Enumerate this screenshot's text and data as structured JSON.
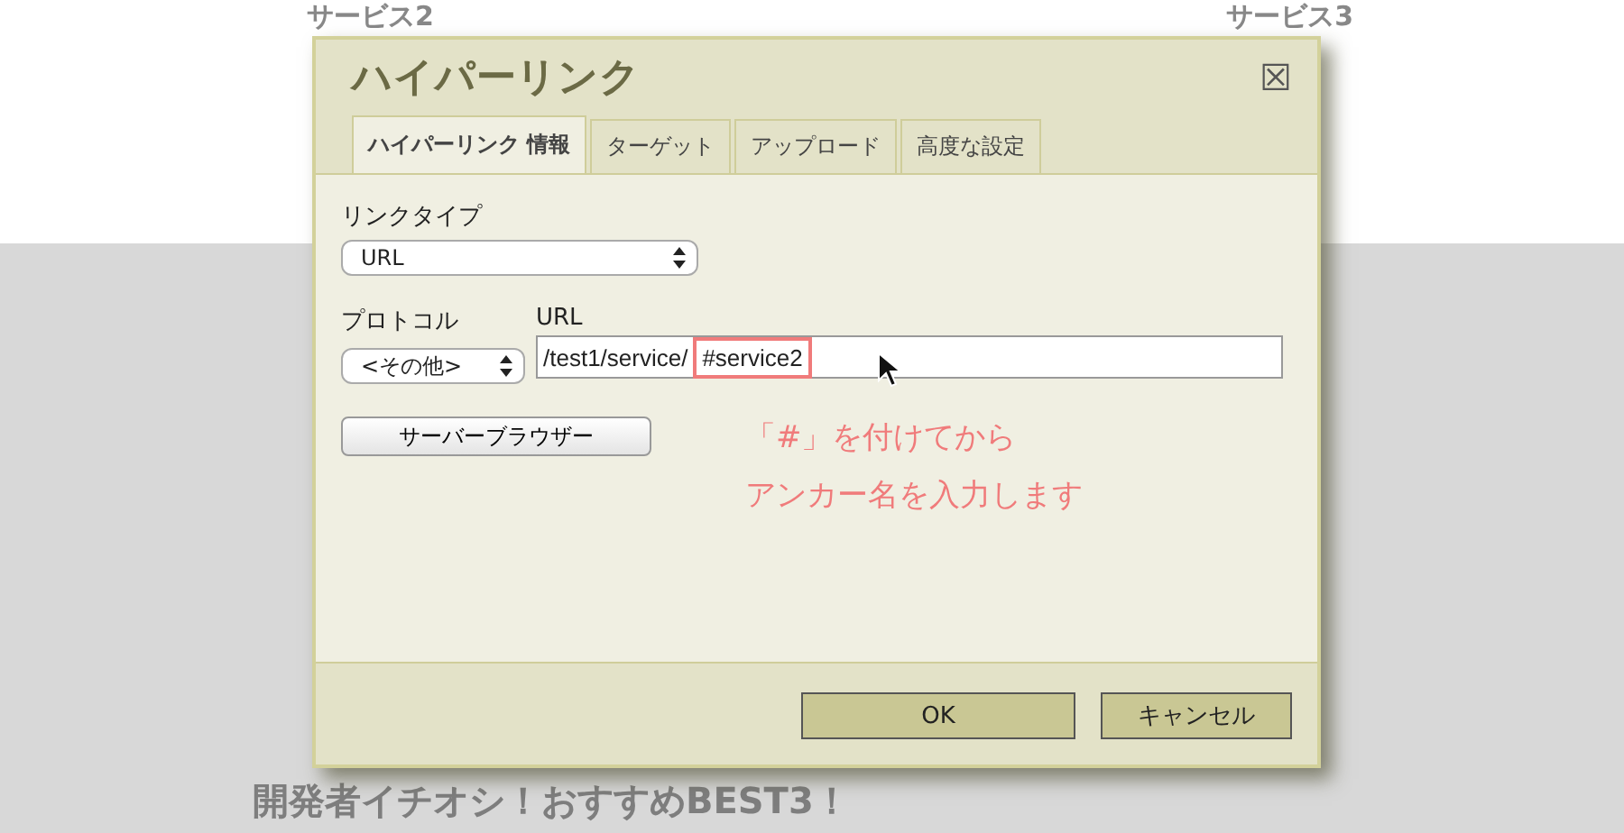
{
  "background": {
    "headings": [
      "サービス2",
      "サービス3"
    ],
    "footer_heading": "開発者イチオシ！おすすめBEST3！"
  },
  "dialog": {
    "title": "ハイパーリンク",
    "close": "☒",
    "tabs": [
      {
        "label": "ハイパーリンク 情報",
        "selected": true
      },
      {
        "label": "ターゲット",
        "selected": false
      },
      {
        "label": "アップロード",
        "selected": false
      },
      {
        "label": "高度な設定",
        "selected": false
      }
    ],
    "link_type": {
      "label": "リンクタイプ",
      "value": "URL"
    },
    "protocol": {
      "label": "プロトコル",
      "value": "<その他>"
    },
    "url": {
      "label": "URL",
      "path": "/test1/service/",
      "anchor": "#service2"
    },
    "browse_button": "サーバーブラウザー",
    "annotation": [
      "「#」を付けてから",
      "アンカー名を入力します"
    ],
    "buttons": [
      "OK",
      "キャンセル"
    ]
  }
}
